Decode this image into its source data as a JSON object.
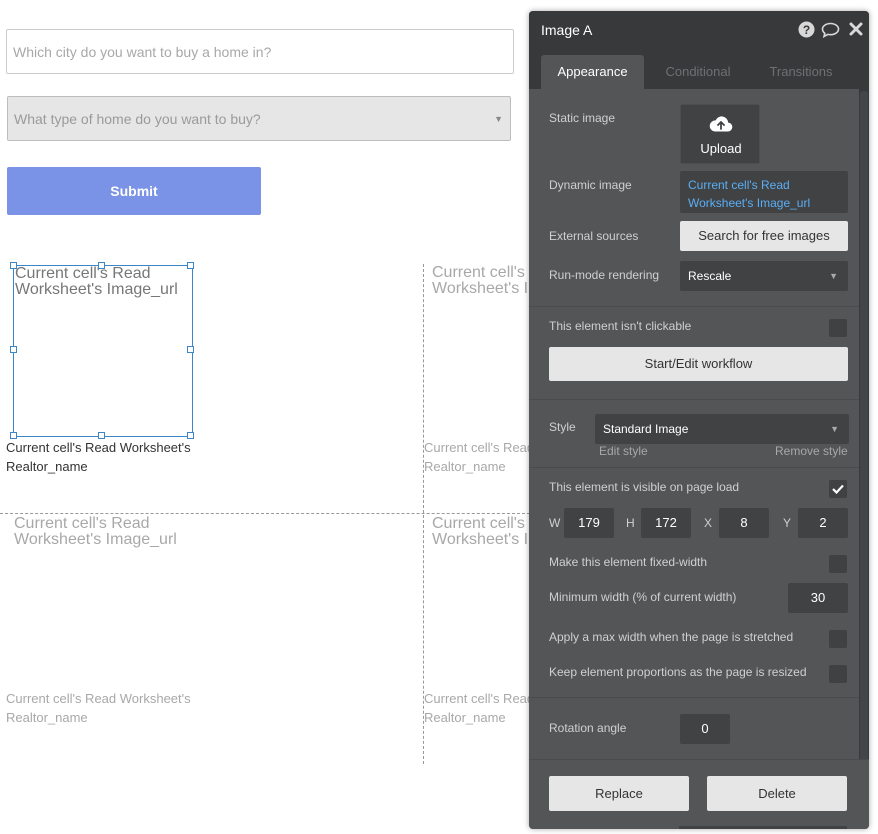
{
  "canvas": {
    "city_input": {
      "placeholder": "Which city do you want to buy a home in?"
    },
    "type_dropdown": {
      "placeholder": "What type of home do you want to buy?"
    },
    "submit_label": "Submit",
    "cells": [
      {
        "image_text": "Current cell's Read Worksheet's Image_url",
        "caption": "Current cell's Read Worksheet's Realtor_name"
      },
      {
        "image_text": "Current cell's Read Worksheet's Image_url",
        "caption": "Current cell's Read Worksheet's Realtor_name"
      },
      {
        "image_text": "Current cell's Read Worksheet's Image_url",
        "caption": "Current cell's Read Worksheet's Realtor_name"
      },
      {
        "image_text": "Current cell's Read Worksheet's Image_url",
        "caption": "Current cell's Read Worksheet's Realtor_name"
      }
    ]
  },
  "panel": {
    "title": "Image A",
    "header_icons": [
      "help-icon",
      "comment-icon",
      "close-icon"
    ],
    "tabs": [
      {
        "label": "Appearance",
        "active": true
      },
      {
        "label": "Conditional",
        "active": false
      },
      {
        "label": "Transitions",
        "active": false
      }
    ],
    "static_image": {
      "label": "Static image",
      "button": "Upload",
      "icon": "upload-cloud-icon"
    },
    "dynamic_image": {
      "label": "Dynamic image",
      "value": "Current cell's Read Worksheet's Image_url"
    },
    "external_sources": {
      "label": "External sources",
      "button": "Search for free images"
    },
    "run_mode": {
      "label": "Run-mode rendering",
      "value": "Rescale"
    },
    "not_clickable": {
      "label": "This element isn't clickable",
      "checked": false
    },
    "workflow_button": "Start/Edit workflow",
    "style": {
      "label": "Style",
      "value": "Standard Image",
      "edit": "Edit style",
      "remove": "Remove style"
    },
    "visible_on_load": {
      "label": "This element is visible on page load",
      "checked": true
    },
    "dimensions": {
      "w_label": "W",
      "w": "179",
      "h_label": "H",
      "h": "172",
      "x_label": "X",
      "x": "8",
      "y_label": "Y",
      "y": "2"
    },
    "fixed_width": {
      "label": "Make this element fixed-width",
      "checked": false
    },
    "min_width": {
      "label": "Minimum width (% of current width)",
      "value": "30"
    },
    "max_width": {
      "label": "Apply a max width when the page is stretched",
      "checked": false
    },
    "keep_proportions": {
      "label": "Keep element proportions as the page is resized",
      "checked": false
    },
    "rotation": {
      "label": "Rotation angle",
      "value": "0"
    },
    "replace_button": "Replace",
    "delete_button": "Delete"
  },
  "colors": {
    "submit_bg": "#7b93e6",
    "panel_bg": "#545556",
    "panel_header": "#38393b",
    "link_blue": "#5aaef4",
    "selection_blue": "#3d86c6"
  }
}
